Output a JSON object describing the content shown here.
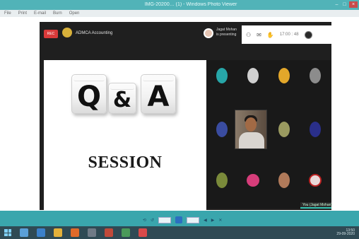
{
  "window": {
    "title": "IMG-20200… (1) - Windows Photo Viewer",
    "controls": [
      "–",
      "□",
      "×"
    ]
  },
  "menubar": {
    "items": [
      "File",
      "Print",
      "E-mail",
      "Burn",
      "Open"
    ]
  },
  "meeting": {
    "rec_label": "REC",
    "meeting_name": "ADMCA Accounting",
    "presenter_name": "Jagat Mohan",
    "presenter_status": "is presenting",
    "toolbar_icons": [
      "participants-icon",
      "chat-icon",
      "raise-hand-icon"
    ],
    "clock": "17:00 : 48"
  },
  "slide": {
    "dice": [
      "Q",
      "&",
      "A"
    ],
    "caption": "SESSION"
  },
  "participants": {
    "self_label": "You (Jagat Mohan)"
  },
  "pdf_toolbar": {
    "items": [
      "⟲",
      "↺",
      "◀",
      "▶",
      "✕"
    ]
  },
  "taskbar": {
    "clock_time": "13:50",
    "clock_date": "29-09-2020"
  },
  "colors": {
    "desktop": "#3aa6ad",
    "meeting_bg": "#1f1f1f",
    "rec": "#d93a3a",
    "accent": "#35c3b1"
  }
}
